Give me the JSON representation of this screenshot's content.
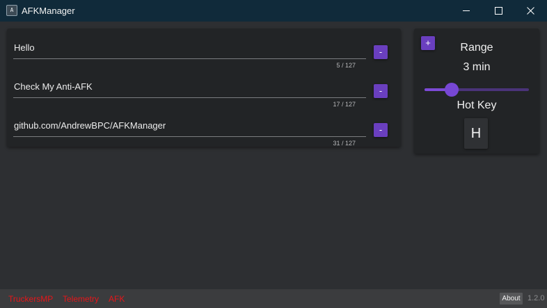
{
  "window": {
    "title": "AFKManager",
    "icon": "app-icon",
    "controls": {
      "minimize_icon": "minimize-icon",
      "maximize_icon": "maximize-icon",
      "close_icon": "close-icon"
    }
  },
  "messages": {
    "remove_label": "-",
    "items": [
      {
        "text": "Hello",
        "count": "5 / 127"
      },
      {
        "text": "Check My Anti-AFK",
        "count": "17 / 127"
      },
      {
        "text": "github.com/AndrewBPC/AFKManager",
        "count": "31 / 127"
      }
    ]
  },
  "settings": {
    "add_label": "+",
    "range_title": "Range",
    "range_value": "3 min",
    "slider_fraction": 0.26,
    "hotkey_title": "Hot Key",
    "hotkey_value": "H"
  },
  "statusbar": {
    "items": [
      "TruckersMP",
      "Telemetry",
      "AFK"
    ],
    "about_label": "About",
    "version": "1.2.0"
  },
  "colors": {
    "accent": "#6a3fbf",
    "titlebar": "#102a3a",
    "status_text": "#e5161a"
  }
}
